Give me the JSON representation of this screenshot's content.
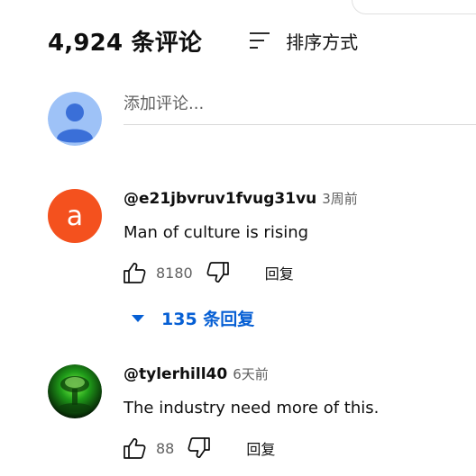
{
  "header": {
    "comment_count": "4,924 条评论",
    "sort_label": "排序方式"
  },
  "add_comment": {
    "placeholder": "添加评论..."
  },
  "comments": [
    {
      "avatar_letter": "a",
      "avatar_color": "#f4511e",
      "author": "@e21jbvruv1fvug31vu",
      "time": "3周前",
      "text": "Man of culture is rising",
      "likes": "8180",
      "reply_label": "回复",
      "replies_label": "135 条回复"
    },
    {
      "author": "@tylerhill40",
      "time": "6天前",
      "text": "The industry need more of this.",
      "likes": "88",
      "reply_label": "回复"
    }
  ],
  "colors": {
    "accent": "#065fd4",
    "text_primary": "#0f0f0f",
    "text_secondary": "#606060"
  }
}
